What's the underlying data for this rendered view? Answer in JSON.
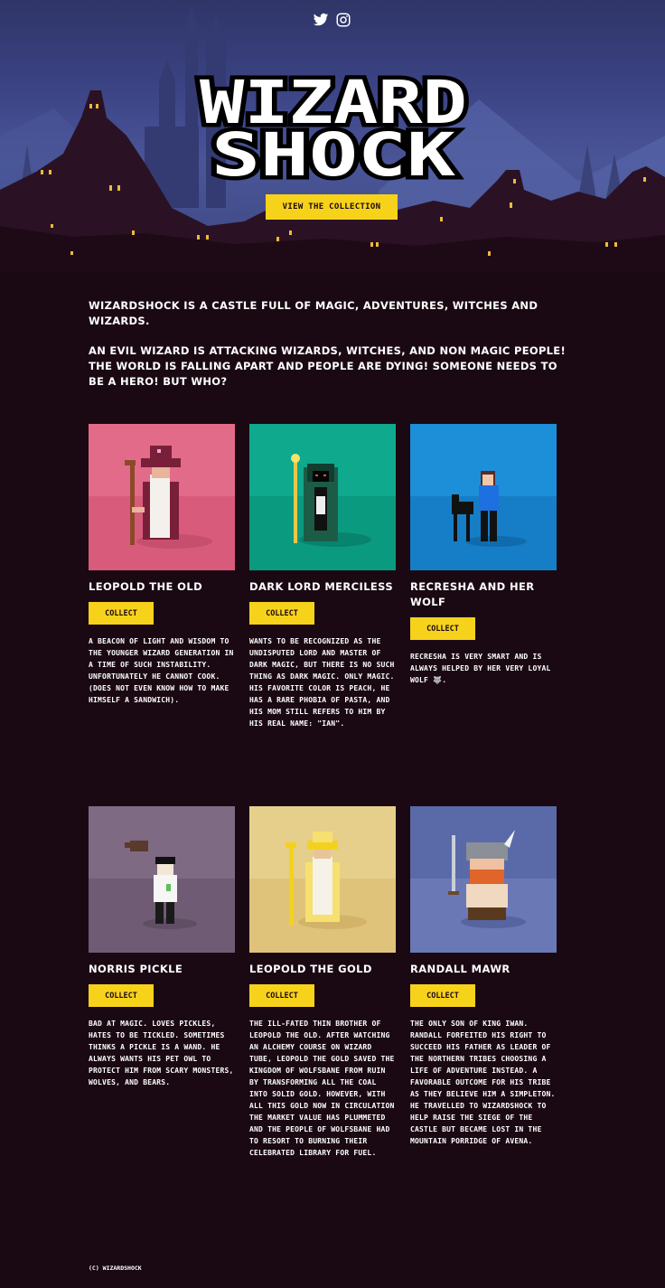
{
  "social": {
    "twitter_icon": "twitter-icon",
    "instagram_icon": "instagram-icon"
  },
  "hero": {
    "logo_line1": "WIZARD",
    "logo_line2": "SHOCK",
    "cta_label": "VIEW THE COLLECTION"
  },
  "intro": {
    "paragraph1": "WIZARDSHOCK IS A CASTLE FULL OF MAGIC, ADVENTURES, WITCHES AND WIZARDS.",
    "paragraph2": "AN EVIL WIZARD IS ATTACKING WIZARDS, WITCHES, AND NON MAGIC PEOPLE! THE WORLD IS FALLING APART AND PEOPLE ARE DYING! SOMEONE NEEDS TO BE A HERO! BUT WHO?"
  },
  "characters": [
    {
      "name": "LEOPOLD THE OLD",
      "button": "COLLECT",
      "bg": "#e26b8a",
      "description": "A BEACON OF LIGHT AND WISDOM TO THE YOUNGER WIZARD GENERATION IN A TIME OF SUCH INSTABILITY. UNFORTUNATELY HE CANNOT COOK. (DOES NOT EVEN KNOW HOW TO MAKE HIMSELF A SANDWICH)."
    },
    {
      "name": "DARK LORD MERCILESS",
      "button": "COLLECT",
      "bg": "#0fa98e",
      "description": "WANTS TO BE RECOGNIZED AS THE UNDISPUTED LORD AND MASTER OF DARK MAGIC, BUT THERE IS NO SUCH THING AS DARK MAGIC. ONLY MAGIC. HIS FAVORITE COLOR IS PEACH, HE HAS A RARE PHOBIA OF PASTA, AND HIS MOM STILL REFERS TO HIM BY HIS REAL NAME: \"IAN\"."
    },
    {
      "name": "RECRESHA AND HER WOLF",
      "button": "COLLECT",
      "bg": "#1d8fd8",
      "description": "RECRESHA IS VERY SMART AND IS ALWAYS HELPED BY HER VERY LOYAL WOLF 🐺."
    },
    {
      "name": "NORRIS PICKLE",
      "button": "COLLECT",
      "bg": "#7e6a82",
      "description": "BAD AT MAGIC. LOVES PICKLES, HATES TO BE TICKLED. SOMETIMES THINKS A PICKLE IS A WAND. HE ALWAYS WANTS HIS PET OWL TO PROTECT HIM FROM SCARY MONSTERS, WOLVES, AND BEARS."
    },
    {
      "name": "LEOPOLD THE GOLD",
      "button": "COLLECT",
      "bg": "#e6cf8a",
      "description": "THE ILL-FATED THIN BROTHER OF LEOPOLD THE OLD. AFTER WATCHING AN ALCHEMY COURSE ON WIZARD TUBE, LEOPOLD THE GOLD SAVED THE KINGDOM OF WOLFSBANE FROM RUIN BY TRANSFORMING ALL THE COAL INTO SOLID GOLD. HOWEVER, WITH ALL THIS GOLD NOW IN CIRCULATION THE MARKET VALUE HAS PLUMMETED AND THE PEOPLE OF WOLFSBANE HAD TO RESORT TO BURNING THEIR CELEBRATED LIBRARY FOR FUEL."
    },
    {
      "name": "RANDALL MAWR",
      "button": "COLLECT",
      "bg": "#6a78b6",
      "description": "THE ONLY SON OF KING IWAN. RANDALL FORFEITED HIS RIGHT TO SUCCEED HIS FATHER AS LEADER OF THE NORTHERN TRIBES CHOOSING A LIFE OF ADVENTURE INSTEAD. A FAVORABLE OUTCOME FOR HIS TRIBE AS THEY BELIEVE HIM A SIMPLETON. HE TRAVELLED TO WIZARDSHOCK TO HELP RAISE THE SIEGE OF THE CASTLE BUT BECAME LOST IN THE MOUNTAIN PORRIDGE OF AVENA."
    }
  ],
  "footer": {
    "copyright": "(C) WIZARDSHOCK"
  }
}
